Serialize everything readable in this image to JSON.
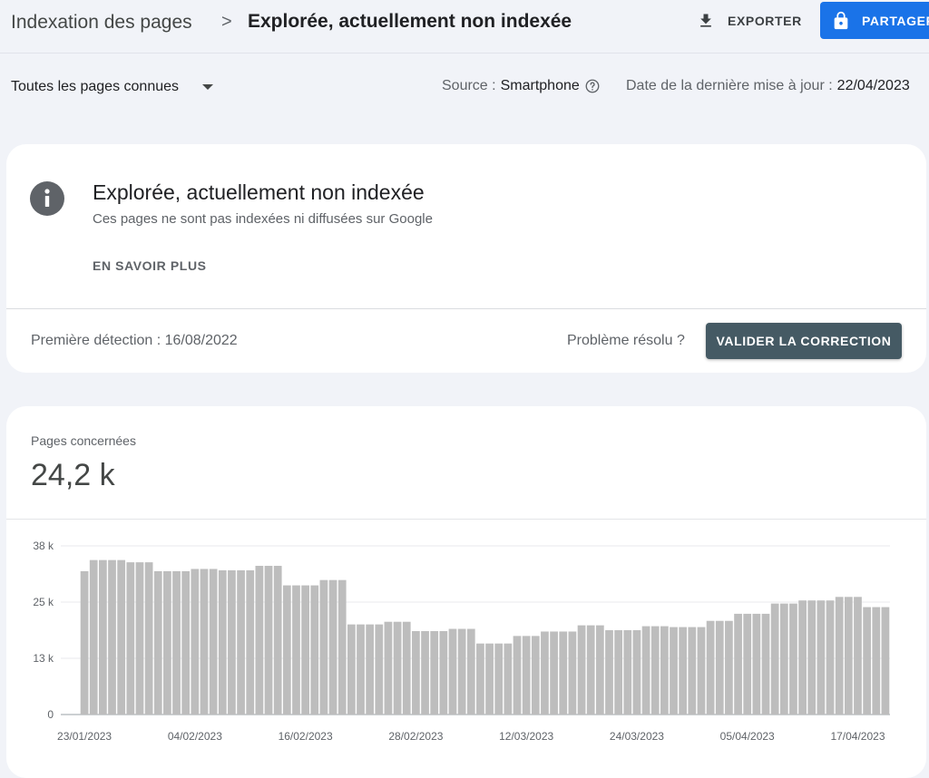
{
  "header": {
    "breadcrumb_root": "Indexation des pages",
    "breadcrumb_separator": ">",
    "breadcrumb_current": "Explorée, actuellement non indexée",
    "export_label": "EXPORTER",
    "share_label": "PARTAGER"
  },
  "filters": {
    "pages_select": "Toutes les pages connues",
    "source_label": "Source :",
    "source_value": "Smartphone",
    "update_label": "Date de la dernière mise à jour :",
    "update_value": "22/04/2023"
  },
  "issue": {
    "title": "Explorée, actuellement non indexée",
    "description": "Ces pages ne sont pas indexées ni diffusées sur Google",
    "learn_more": "EN SAVOIR PLUS",
    "first_detection": "Première détection : 16/08/2022",
    "resolved_question": "Problème résolu ?",
    "validate_label": "VALIDER LA CORRECTION"
  },
  "metric": {
    "label": "Pages concernées",
    "value": "24,2 k"
  },
  "colors": {
    "primary_blue": "#1a73e8",
    "validate_button": "#455a64",
    "bars": "#bdbdbd"
  },
  "icons": [
    "download-icon",
    "lock-icon",
    "help-circle-icon",
    "info-icon",
    "dropdown-arrow-icon"
  ],
  "chart_data": {
    "type": "bar",
    "start_date": "2023-01-23",
    "end_date": "2023-04-20",
    "y_ticks": [
      "0",
      "13 k",
      "25 k",
      "38 k"
    ],
    "y_tick_values": [
      0,
      12666,
      25333,
      38000
    ],
    "ylim": [
      0,
      38000
    ],
    "x_tick_labels": [
      "23/01/2023",
      "04/02/2023",
      "16/02/2023",
      "28/02/2023",
      "12/03/2023",
      "24/03/2023",
      "05/04/2023",
      "17/04/2023"
    ],
    "x_tick_dates": [
      "2023-01-23",
      "2023-02-04",
      "2023-02-16",
      "2023-02-28",
      "2023-03-12",
      "2023-03-24",
      "2023-04-05",
      "2023-04-17"
    ],
    "values": [
      32300,
      34800,
      34800,
      34800,
      34800,
      34300,
      34300,
      34300,
      32300,
      32300,
      32300,
      32300,
      32800,
      32800,
      32800,
      32500,
      32500,
      32500,
      32500,
      33500,
      33500,
      33500,
      29100,
      29100,
      29100,
      29100,
      30300,
      30300,
      30300,
      20300,
      20300,
      20300,
      20300,
      20900,
      20900,
      20900,
      18800,
      18800,
      18800,
      18800,
      19300,
      19300,
      19300,
      16000,
      16000,
      16000,
      16000,
      17700,
      17700,
      17700,
      18700,
      18700,
      18700,
      18700,
      20100,
      20100,
      20100,
      19000,
      19000,
      19000,
      19000,
      19900,
      19900,
      19900,
      19700,
      19700,
      19700,
      19700,
      21100,
      21100,
      21100,
      22700,
      22700,
      22700,
      22700,
      25000,
      25000,
      25000,
      25700,
      25700,
      25700,
      25700,
      26500,
      26500,
      26500,
      24200,
      24200,
      24200
    ],
    "grid": true,
    "legend": "none"
  }
}
